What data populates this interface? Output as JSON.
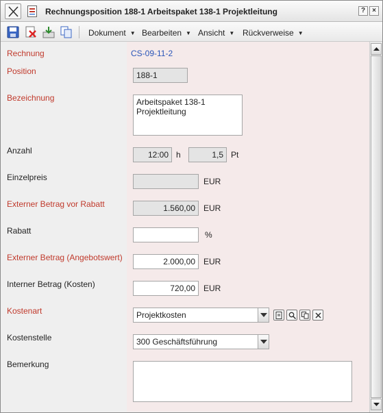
{
  "window": {
    "title": "Rechnungsposition 188-1 Arbeitspaket 138-1 Projektleitung",
    "help_label": "?",
    "maximize_label": "□",
    "close_label": "×"
  },
  "toolbar": {
    "menus": [
      {
        "label": "Dokument"
      },
      {
        "label": "Bearbeiten"
      },
      {
        "label": "Ansicht"
      },
      {
        "label": "Rückverweise"
      }
    ]
  },
  "form": {
    "rechnung": {
      "label": "Rechnung",
      "value": "CS-09-11-2"
    },
    "position": {
      "label": "Position",
      "value": "188-1"
    },
    "bezeichnung": {
      "label": "Bezeichnung",
      "line1": "Arbeitspaket 138-1",
      "line2": "Projektleitung"
    },
    "anzahl": {
      "label": "Anzahl",
      "hours": "12:00",
      "hours_unit": "h",
      "points": "1,5",
      "points_unit": "Pt"
    },
    "einzelpreis": {
      "label": "Einzelpreis",
      "value": "",
      "unit": "EUR"
    },
    "extern_vor_rabatt": {
      "label": "Externer Betrag vor Rabatt",
      "value": "1.560,00",
      "unit": "EUR"
    },
    "rabatt": {
      "label": "Rabatt",
      "value": "",
      "unit": "%"
    },
    "extern_angebot": {
      "label": "Externer Betrag (Angebotswert)",
      "value": "2.000,00",
      "unit": "EUR"
    },
    "intern_kosten": {
      "label": "Interner Betrag (Kosten)",
      "value": "720,00",
      "unit": "EUR"
    },
    "kostenart": {
      "label": "Kostenart",
      "value": "Projektkosten"
    },
    "kostenstelle": {
      "label": "Kostenstelle",
      "value": "300 Geschäftsführung"
    },
    "bemerkung": {
      "label": "Bemerkung",
      "value": ""
    }
  },
  "colors": {
    "required_label": "#c0392b",
    "link": "#2a55b8",
    "right_pane_bg": "#f5eaea"
  }
}
